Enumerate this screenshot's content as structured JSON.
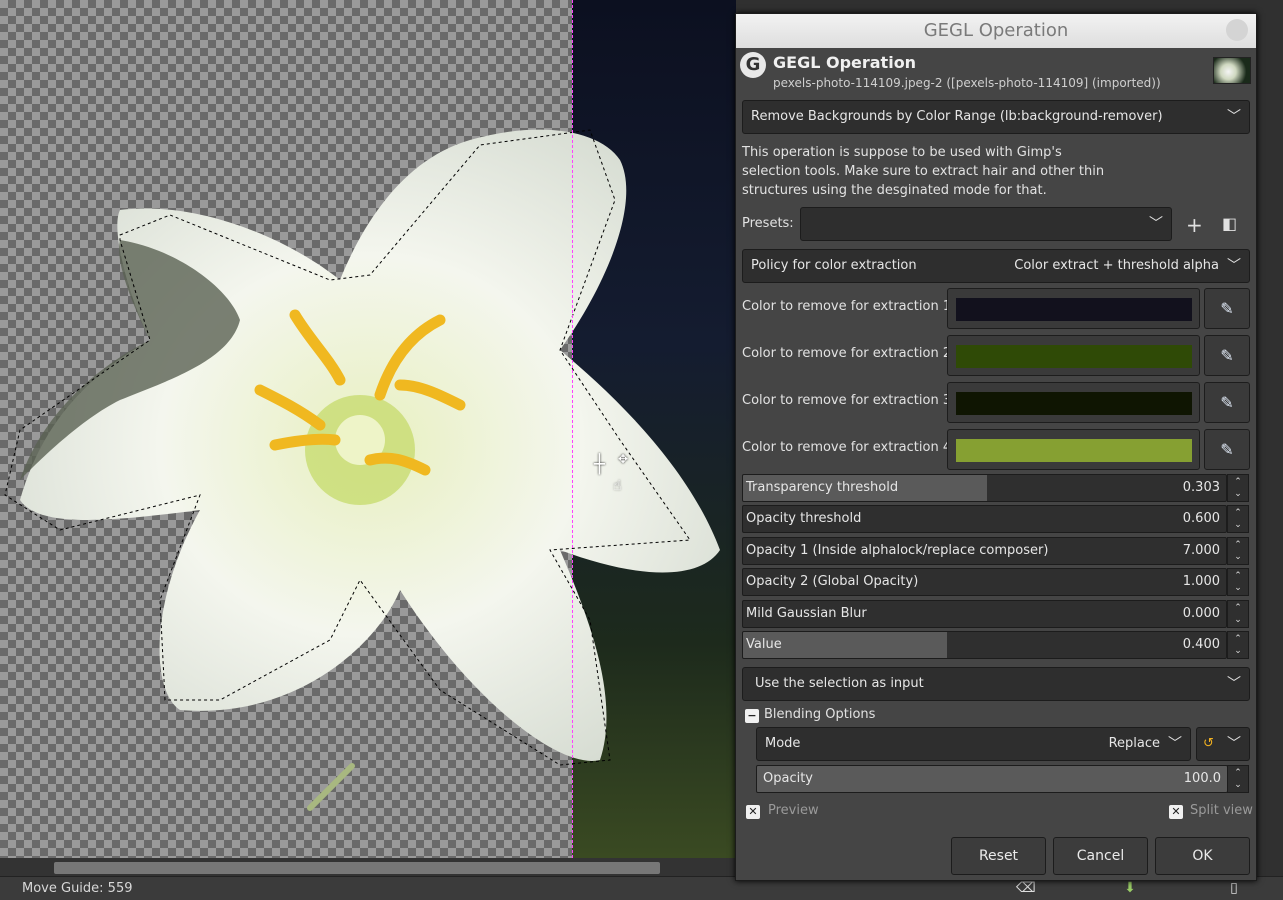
{
  "status": {
    "text": "Move Guide: 559"
  },
  "dialog": {
    "window_title": "GEGL Operation",
    "header_title": "GEGL Operation",
    "header_subtitle": "pexels-photo-114109.jpeg-2 ([pexels-photo-114109] (imported))",
    "operation": "Remove Backgrounds by Color Range (lb:background-remover)",
    "description": "This operation is suppose to be used with Gimp's selection tools. Make sure to extract hair and other thin structures using the desginated mode for that.",
    "presets_label": "Presets:",
    "presets_value": "",
    "policy_label": "Policy for color extraction",
    "policy_value": "Color extract + threshold alpha",
    "colors": [
      {
        "label": "Color to remove for extraction 1",
        "color": "#12111d"
      },
      {
        "label": "Color to remove for extraction 2",
        "color": "#2f4a06"
      },
      {
        "label": "Color to remove for extraction 3",
        "color": "#0f1502"
      },
      {
        "label": "Color to remove for extraction 4",
        "color": "#86a032"
      }
    ],
    "sliders": [
      {
        "label": "Transparency threshold",
        "value": "0.303",
        "fill": 0.506
      },
      {
        "label": "Opacity threshold",
        "value": "0.600",
        "fill": 0
      },
      {
        "label": "Opacity 1 (Inside alphalock/replace composer)",
        "value": "7.000",
        "fill": 0
      },
      {
        "label": "Opacity 2 (Global Opacity)",
        "value": "1.000",
        "fill": 0
      },
      {
        "label": "Mild Gaussian Blur",
        "value": "0.000",
        "fill": 0
      },
      {
        "label": "Value",
        "value": "0.400",
        "fill": 0.423
      }
    ],
    "input_mode": "Use the selection as input",
    "blending_label": "Blending Options",
    "mode_label": "Mode",
    "mode_value": "Replace",
    "opacity_label": "Opacity",
    "opacity_value": "100.0",
    "preview_label": "Preview",
    "split_label": "Split view",
    "buttons": {
      "reset": "Reset",
      "cancel": "Cancel",
      "ok": "OK"
    }
  }
}
